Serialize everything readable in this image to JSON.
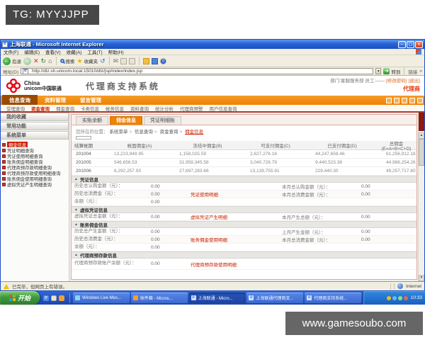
{
  "overlay": {
    "tg": "TG: MYYJJPP",
    "watermark": "www.gamesoubo.com"
  },
  "ie": {
    "title": "上海联通 - Microsoft Internet Explorer",
    "menus": [
      "文件(F)",
      "编辑(E)",
      "查看(V)",
      "收藏(A)",
      "工具(T)",
      "帮助(H)"
    ],
    "toolbar": {
      "back": "后退",
      "search": "搜索",
      "favorites": "收藏夹"
    },
    "address": {
      "label": "地址(D)",
      "url": "http://dlz.sh.unicom.local:15010/dlz/jsp/index/index.jsp",
      "go": "转到",
      "links": "链接"
    }
  },
  "site": {
    "brand_line1": "China",
    "brand_line2": "unicom中国联通",
    "system_title": "代理商支持系统",
    "user": {
      "dept": "部门:客服服务部",
      "emp": "员工:——",
      "change_pwd": "[修改密码]",
      "logout": "[退出]",
      "role": "代理商"
    },
    "nav": [
      "信息查询",
      "资料管理",
      "留言管理"
    ],
    "subnav": [
      "受理查询",
      "资金查询",
      "佣金查询",
      "卡类信息",
      "帐务信息",
      "资料查询",
      "统计分析",
      "代理商预警",
      "用户信息查询"
    ]
  },
  "sidebar": {
    "sections": [
      "我的收藏",
      "常用功能",
      "系统菜单"
    ],
    "items": [
      "佣金信息",
      "凭证明细查询",
      "凭证使用明细查询",
      "账务佣金明细查询",
      "代理商预存款明细查询",
      "代理商预存款使用明细查询",
      "账务佣金使用明细查询",
      "虚拟凭证产生明细查询"
    ]
  },
  "main": {
    "tabs": [
      "实账余额",
      "佣金信息",
      "凭证明细账"
    ],
    "breadcrumb": {
      "prefix": "您所在的位置：",
      "path": [
        "系统菜单",
        "信息查询",
        "资金查询",
        "佣金信息"
      ]
    },
    "table": {
      "headers": [
        "结算帐期",
        "帐面佣金(A)",
        "冻结中佣金(B)",
        "可支付佣金(C)",
        "已支付佣金(D)",
        "总佣金(E=A+B+C+D)"
      ],
      "rows": [
        [
          "201004",
          "13,223,949.95",
          "1,158,025.59",
          "2,627,276.16",
          "44,247,658.46",
          "61,256,912.18"
        ],
        [
          "201005",
          "546,656.53",
          "31,958,345.58",
          "3,040,728.79",
          "9,440,523.36",
          "44,986,254.26"
        ],
        [
          "201006",
          "8,292,257.93",
          "27,697,283.66",
          "13,139,755.91",
          "229,440.30",
          "49,257,717.80"
        ]
      ]
    },
    "sections": [
      {
        "title": "凭证信息",
        "rows": [
          {
            "l1": "历史总认购金额（元）：",
            "v1": "0.00",
            "link": "",
            "l2": "本月总认购金额（元）：",
            "v2": "0.00"
          },
          {
            "l1": "历史总消费金（元）：",
            "v1": "0.00",
            "link": "凭证使用明细",
            "l2": "本月总消费金额（元）：",
            "v2": "0.00"
          },
          {
            "l1": "余额（元）：",
            "v1": "0.00",
            "link": "",
            "l2": "",
            "v2": ""
          }
        ]
      },
      {
        "title": "虚拟凭证信息",
        "rows": [
          {
            "l1": "虚拟凭证总金额（元）：",
            "v1": "0.00",
            "link": "虚拟凭证产生明细",
            "l2": "本月产生总额（元）：",
            "v2": "0.00"
          }
        ]
      },
      {
        "title": "账务佣金信息",
        "rows": [
          {
            "l1": "历史总产生金额（元）：",
            "v1": "0.00",
            "link": "",
            "l2": "上月产生金额（元）：",
            "v2": "0.00"
          },
          {
            "l1": "历史总消费金（元）：",
            "v1": "0.00",
            "link": "账务佣金使用明细",
            "l2": "本月总消费金额（元）：",
            "v2": "0.00"
          },
          {
            "l1": "余额（元）：",
            "v1": "0.00",
            "link": "",
            "l2": "",
            "v2": ""
          }
        ]
      },
      {
        "title": "代理商预存款信息",
        "rows": [
          {
            "l1": "代理商预存款账户余额（元）：",
            "v1": "0.00",
            "link": "代理商预存款使用明细",
            "l2": "",
            "v2": ""
          }
        ]
      }
    ]
  },
  "statusbar": {
    "status": "已完毕，但网页上有错误。",
    "zone": "Internet"
  },
  "taskbar": {
    "start": "开始",
    "tasks": [
      "Windows Live Mes...",
      "收件箱 - Micros...",
      "上海联通 - Micro...",
      "上海联通代理商支...",
      "代理商支持系统..."
    ],
    "time": "10:33"
  },
  "colors": {
    "accent_orange": "#ef8200",
    "brand_red": "#e60012",
    "link_red": "#cc2200",
    "xp_blue": "#2456c4"
  }
}
